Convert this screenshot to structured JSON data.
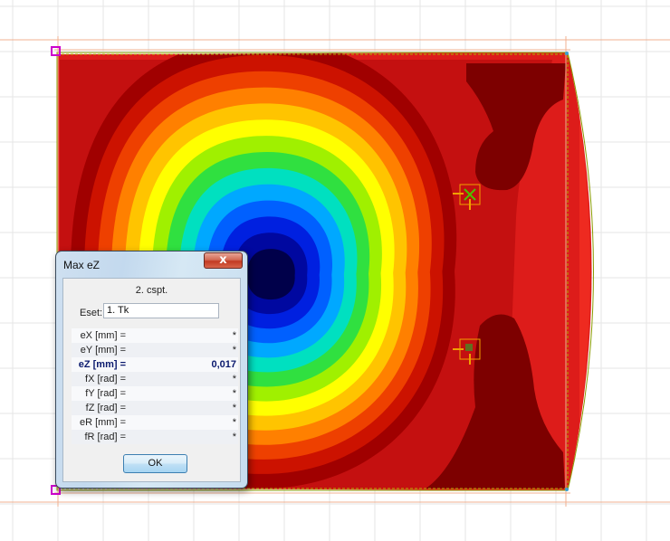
{
  "dialog": {
    "title": "Max eZ",
    "close_label": "x",
    "subtitle": "2. cspt.",
    "eset_label": "Eset:",
    "eset_value": "1. Tk",
    "rows": [
      {
        "label": "eX [mm] =",
        "value": "*"
      },
      {
        "label": "eY [mm] =",
        "value": "*"
      },
      {
        "label": "eZ [mm] =",
        "value": "0,017"
      },
      {
        "label": "fX [rad] =",
        "value": "*"
      },
      {
        "label": "fY [rad] =",
        "value": "*"
      },
      {
        "label": "fZ [rad] =",
        "value": "*"
      },
      {
        "label": "eR [mm] =",
        "value": "*"
      },
      {
        "label": "fR [rad] =",
        "value": "*"
      }
    ],
    "ok_label": "OK"
  },
  "colors": {
    "contour_scale": [
      "#7a0000",
      "#a00000",
      "#cc1200",
      "#ee4000",
      "#ff8000",
      "#ffc400",
      "#ffff00",
      "#a0f000",
      "#30e040",
      "#00e0c0",
      "#00a8ff",
      "#0060ff",
      "#0020e0",
      "#0008a0",
      "#00004a"
    ],
    "plate_fill": "#dd1c1a",
    "dark_region": "#7d0000",
    "grid_line": "#e6e6e6",
    "outline": "#f0a080",
    "support_marker": "#cc00cc",
    "dialog_highlight": "#0b1a6e"
  },
  "icons": [
    "support-marker-icon",
    "node-load-icon",
    "close-icon"
  ]
}
